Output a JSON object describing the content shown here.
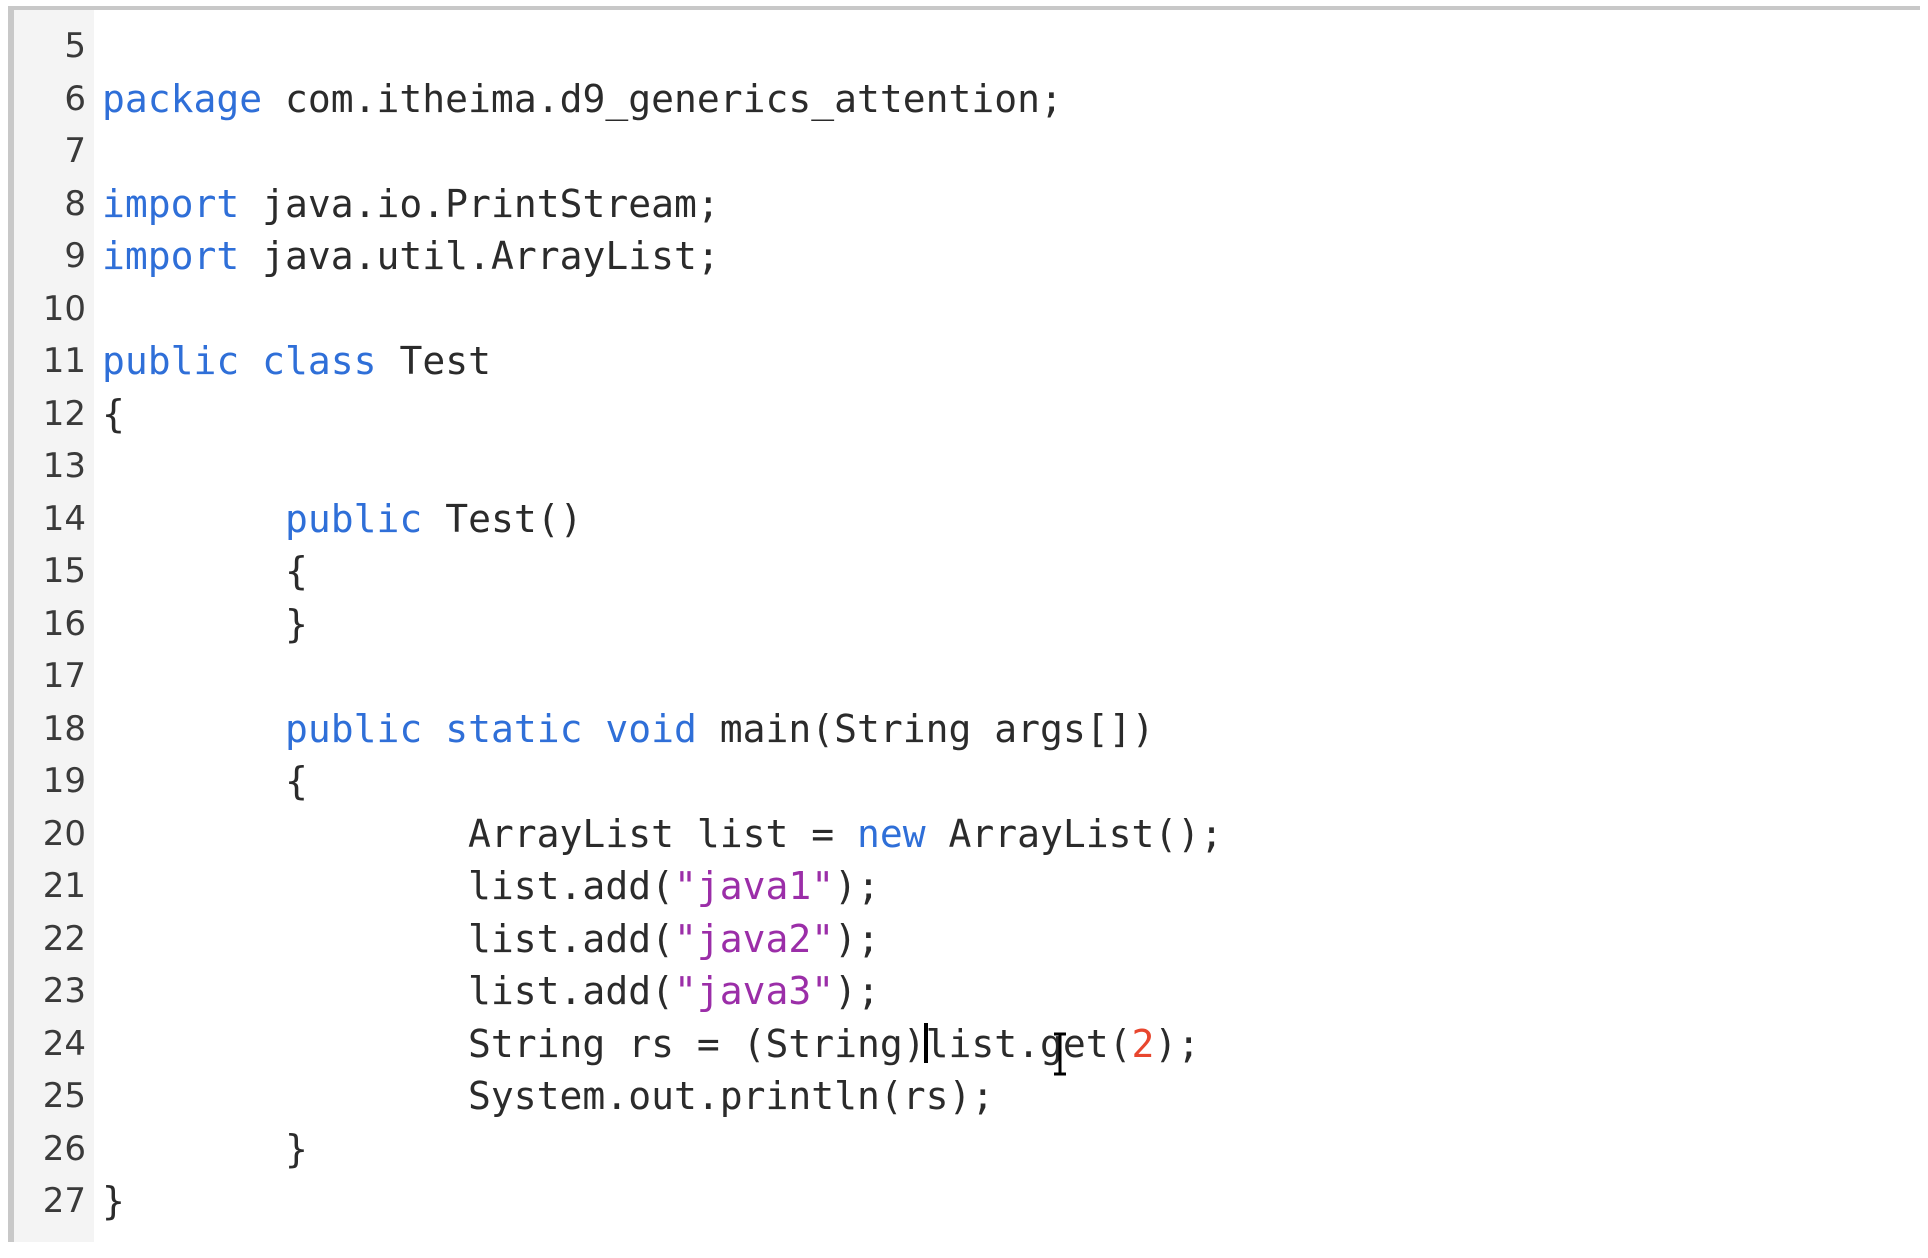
{
  "editor": {
    "lines": [
      {
        "n": "5",
        "tokens": []
      },
      {
        "n": "6",
        "tokens": [
          {
            "t": "package",
            "c": "kw"
          },
          {
            "t": " com.itheima.d9_generics_attention;",
            "c": "pl"
          }
        ]
      },
      {
        "n": "7",
        "tokens": []
      },
      {
        "n": "8",
        "tokens": [
          {
            "t": "import",
            "c": "kw"
          },
          {
            "t": " java.io.PrintStream;",
            "c": "pl"
          }
        ]
      },
      {
        "n": "9",
        "tokens": [
          {
            "t": "import",
            "c": "kw"
          },
          {
            "t": " java.util.ArrayList;",
            "c": "pl"
          }
        ]
      },
      {
        "n": "10",
        "tokens": []
      },
      {
        "n": "11",
        "tokens": [
          {
            "t": "public",
            "c": "kw"
          },
          {
            "t": " ",
            "c": "pl"
          },
          {
            "t": "class",
            "c": "kw"
          },
          {
            "t": " Test",
            "c": "pl"
          }
        ]
      },
      {
        "n": "12",
        "tokens": [
          {
            "t": "{",
            "c": "pl"
          }
        ]
      },
      {
        "n": "13",
        "tokens": []
      },
      {
        "n": "14",
        "tokens": [
          {
            "t": "        ",
            "c": "pl"
          },
          {
            "t": "public",
            "c": "kw"
          },
          {
            "t": " Test()",
            "c": "pl"
          }
        ]
      },
      {
        "n": "15",
        "tokens": [
          {
            "t": "        {",
            "c": "pl"
          }
        ]
      },
      {
        "n": "16",
        "tokens": [
          {
            "t": "        }",
            "c": "pl"
          }
        ]
      },
      {
        "n": "17",
        "tokens": []
      },
      {
        "n": "18",
        "tokens": [
          {
            "t": "        ",
            "c": "pl"
          },
          {
            "t": "public",
            "c": "kw"
          },
          {
            "t": " ",
            "c": "pl"
          },
          {
            "t": "static",
            "c": "kw"
          },
          {
            "t": " ",
            "c": "pl"
          },
          {
            "t": "void",
            "c": "kw"
          },
          {
            "t": " main(String args[])",
            "c": "pl"
          }
        ]
      },
      {
        "n": "19",
        "tokens": [
          {
            "t": "        {",
            "c": "pl"
          }
        ]
      },
      {
        "n": "20",
        "tokens": [
          {
            "t": "                ArrayList list = ",
            "c": "pl"
          },
          {
            "t": "new",
            "c": "kw"
          },
          {
            "t": " ArrayList();",
            "c": "pl"
          }
        ]
      },
      {
        "n": "21",
        "tokens": [
          {
            "t": "                list.add(",
            "c": "pl"
          },
          {
            "t": "\"java1\"",
            "c": "str"
          },
          {
            "t": ");",
            "c": "pl"
          }
        ]
      },
      {
        "n": "22",
        "tokens": [
          {
            "t": "                list.add(",
            "c": "pl"
          },
          {
            "t": "\"java2\"",
            "c": "str"
          },
          {
            "t": ");",
            "c": "pl"
          }
        ]
      },
      {
        "n": "23",
        "tokens": [
          {
            "t": "                list.add(",
            "c": "pl"
          },
          {
            "t": "\"java3\"",
            "c": "str"
          },
          {
            "t": ");",
            "c": "pl"
          }
        ]
      },
      {
        "n": "24",
        "tokens": [
          {
            "t": "                String rs = (String)",
            "c": "pl"
          },
          {
            "t": "",
            "c": "caret"
          },
          {
            "t": "list.get(",
            "c": "pl"
          },
          {
            "t": "2",
            "c": "num"
          },
          {
            "t": ");",
            "c": "pl"
          }
        ]
      },
      {
        "n": "25",
        "tokens": [
          {
            "t": "                System.out.println(rs);",
            "c": "pl"
          }
        ]
      },
      {
        "n": "26",
        "tokens": [
          {
            "t": "        }",
            "c": "pl"
          }
        ]
      },
      {
        "n": "27",
        "tokens": [
          {
            "t": "}",
            "c": "pl"
          }
        ]
      }
    ],
    "colors": {
      "keyword": "#2f6fd8",
      "string": "#9b2ea8",
      "number": "#e8462e",
      "plain": "#2b2b2b",
      "gutter": "#f4f4f4"
    },
    "cursor_icon": "i-beam-cursor-icon"
  }
}
